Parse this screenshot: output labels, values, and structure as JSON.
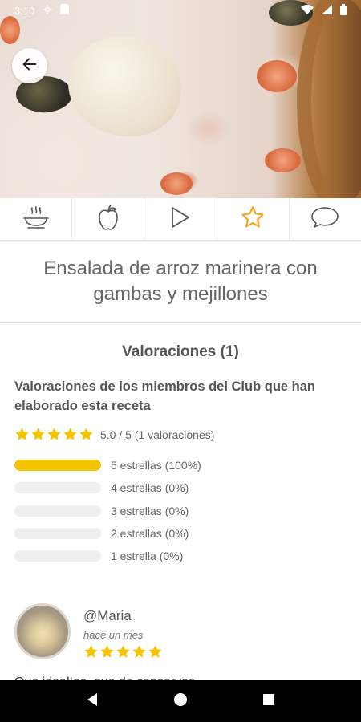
{
  "status_bar": {
    "time": "3:10"
  },
  "hero": {
    "image_alt": "Ensalada de arroz marinera con gambas y mejillones"
  },
  "toolbar": {
    "tabs": [
      {
        "icon": "cooking-pot-icon"
      },
      {
        "icon": "apple-icon"
      },
      {
        "icon": "play-icon"
      },
      {
        "icon": "star-icon",
        "active": true
      },
      {
        "icon": "comment-icon"
      }
    ],
    "active_color": "#f5a623"
  },
  "recipe": {
    "title": "Ensalada de arroz marinera con gambas y mejillones"
  },
  "ratings": {
    "heading": "Valoraciones (1)",
    "members_heading": "Valoraciones de los miembros del Club que han elaborado esta receta",
    "summary": "5.0 / 5 (1 valoraciones)",
    "average_stars": 5,
    "distribution": [
      {
        "label": "5 estrellas (100%)",
        "fraction": 1.0
      },
      {
        "label": "4 estrellas (0%)",
        "fraction": 0
      },
      {
        "label": "3 estrellas (0%)",
        "fraction": 0
      },
      {
        "label": "2 estrellas (0%)",
        "fraction": 0
      },
      {
        "label": "1 estrella (0%)",
        "fraction": 0
      }
    ],
    "star_color": "#f5c400"
  },
  "review": {
    "author": "@Maria",
    "time": "hace un mes",
    "stars": 5,
    "text": "Que ideal!os, que de conservas?...(cut off)"
  }
}
